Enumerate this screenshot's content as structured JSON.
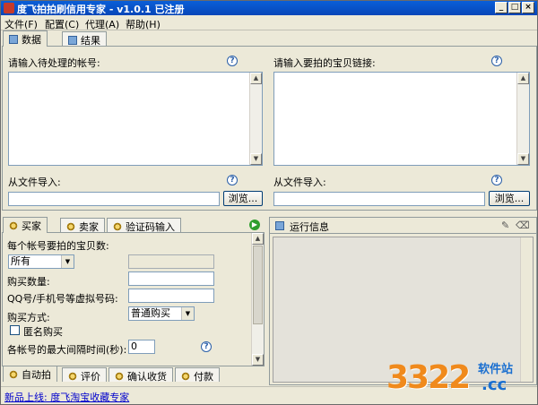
{
  "window": {
    "title": "度飞拍拍刷信用专家 - v1.0.1 已注册",
    "controls": {
      "minimize": "_",
      "maximize": "□",
      "close": "×"
    }
  },
  "menu": [
    {
      "label": "文件(F)"
    },
    {
      "label": "配置(C)"
    },
    {
      "label": "代理(A)"
    },
    {
      "label": "帮助(H)"
    }
  ],
  "main_tabs": [
    {
      "label": "数据",
      "active": true
    },
    {
      "label": "结果",
      "active": false
    }
  ],
  "accounts": {
    "label": "请输入待处理的帐号:",
    "help": "?",
    "import_label": "从文件导入:",
    "browse_label": "浏览..."
  },
  "links": {
    "label": "请输入要拍的宝贝链接:",
    "help": "?",
    "import_label": "从文件导入:",
    "browse_label": "浏览..."
  },
  "role_tabs": [
    {
      "label": "买家",
      "active": true
    },
    {
      "label": "卖家",
      "active": false
    },
    {
      "label": "验证码输入",
      "active": false
    }
  ],
  "buyer_form": {
    "items_per_account_label": "每个帐号要拍的宝贝数:",
    "items_select": "所有",
    "quantity_label": "购买数量:",
    "qq_label": "QQ号/手机号等虚拟号码:",
    "method_label": "购买方式:",
    "method_select": "普通购买",
    "anonymous_label": "匿名购买",
    "interval_label": "各帐号的最大间隔时间(秒):",
    "interval_value": "0",
    "help": "?"
  },
  "bottom_tabs": [
    {
      "label": "自动拍",
      "active": true
    },
    {
      "label": "评价",
      "active": false
    },
    {
      "label": "确认收货",
      "active": false
    },
    {
      "label": "付款",
      "active": false
    }
  ],
  "run_info": {
    "title": "运行信息"
  },
  "status": {
    "news": "新品上线: 度飞淘宝收藏专家"
  },
  "watermark": {
    "number": "3322",
    "site": "软件站",
    "domain": ".cc"
  },
  "colors": {
    "title_bar": "#0746b8",
    "panel_bg": "#ece9d8",
    "link": "#0000cc",
    "watermark_orange": "#f08a1c",
    "watermark_blue": "#1a6fd0"
  }
}
